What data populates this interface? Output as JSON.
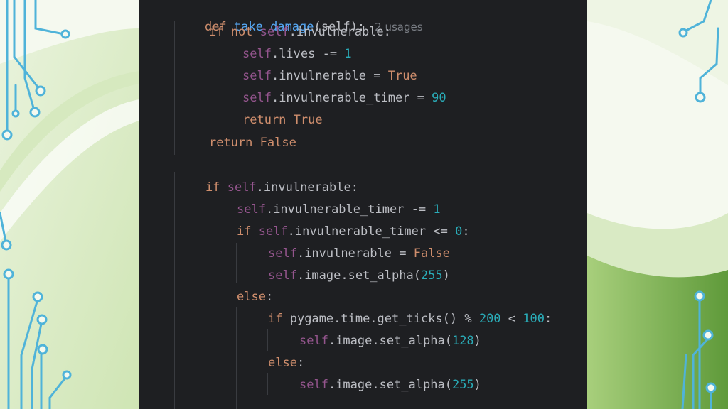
{
  "code": {
    "def_kw": "def",
    "fn_name": "take_damage",
    "fn_sig": "(self):",
    "usages_hint": "2 usages",
    "lines": {
      "l2": {
        "a": "if not ",
        "b": "self",
        "c": ".invulnerable:"
      },
      "l3": {
        "a": "self",
        "b": ".lives -= ",
        "c": "1"
      },
      "l4": {
        "a": "self",
        "b": ".invulnerable = ",
        "c": "True"
      },
      "l5": {
        "a": "self",
        "b": ".invulnerable_timer = ",
        "c": "90"
      },
      "l6": {
        "a": "return True"
      },
      "l7": {
        "a": "return False"
      },
      "l8": {
        "a": "if ",
        "b": "self",
        "c": ".invulnerable:"
      },
      "l9": {
        "a": "self",
        "b": ".invulnerable_timer -= ",
        "c": "1"
      },
      "l10": {
        "a": "if ",
        "b": "self",
        "c": ".invulnerable_timer <= ",
        "d": "0",
        "e": ":"
      },
      "l11": {
        "a": "self",
        "b": ".invulnerable = ",
        "c": "False"
      },
      "l12": {
        "a": "self",
        "b": ".image.set_alpha(",
        "c": "255",
        "d": ")"
      },
      "l13": {
        "a": "else",
        "b": ":"
      },
      "l14": {
        "a": "if ",
        "b": "pygame.time.get_ticks() % ",
        "c": "200",
        "d": " < ",
        "e": "100",
        "f": ":"
      },
      "l15": {
        "a": "self",
        "b": ".image.set_alpha(",
        "c": "128",
        "d": ")"
      },
      "l16": {
        "a": "else",
        "b": ":"
      },
      "l17": {
        "a": "self",
        "b": ".image.set_alpha(",
        "c": "255",
        "d": ")"
      }
    }
  },
  "colors": {
    "editor_bg": "#1e1f22",
    "keyword": "#cf8e6d",
    "self": "#94558d",
    "function": "#56a8f5",
    "number": "#2aacb8",
    "text": "#bcbec4",
    "circuit": "#4fb3d9"
  },
  "icons": [
    "circuit-decoration-left",
    "circuit-decoration-right"
  ]
}
